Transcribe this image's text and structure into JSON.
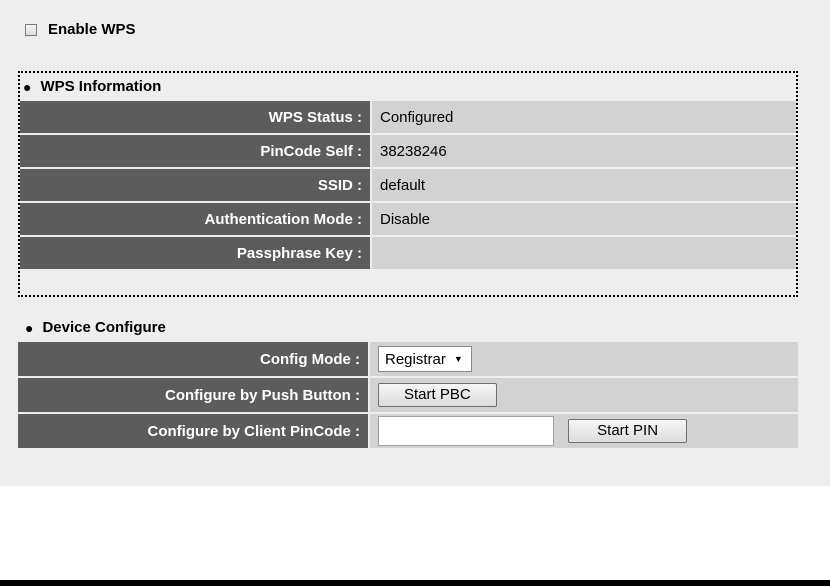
{
  "enable_wps": {
    "label": "Enable WPS",
    "checked": false
  },
  "wps_info": {
    "title": "WPS Information",
    "rows": [
      {
        "label": "WPS Status :",
        "value": "Configured"
      },
      {
        "label": "PinCode Self :",
        "value": "38238246"
      },
      {
        "label": "SSID :",
        "value": "default"
      },
      {
        "label": "Authentication Mode :",
        "value": "Disable"
      },
      {
        "label": "Passphrase Key :",
        "value": ""
      }
    ]
  },
  "device_configure": {
    "title": "Device Configure",
    "config_mode_label": "Config Mode :",
    "config_mode_value": "Registrar",
    "push_button_label": "Configure by Push Button :",
    "start_pbc_label": "Start PBC",
    "client_pin_label": "Configure by Client PinCode :",
    "client_pin_value": "",
    "start_pin_label": "Start PIN"
  },
  "colors": {
    "key_cell": "#5c5c5c",
    "value_cell": "#d2d2d2",
    "panel_bg": "#eeeeee"
  }
}
